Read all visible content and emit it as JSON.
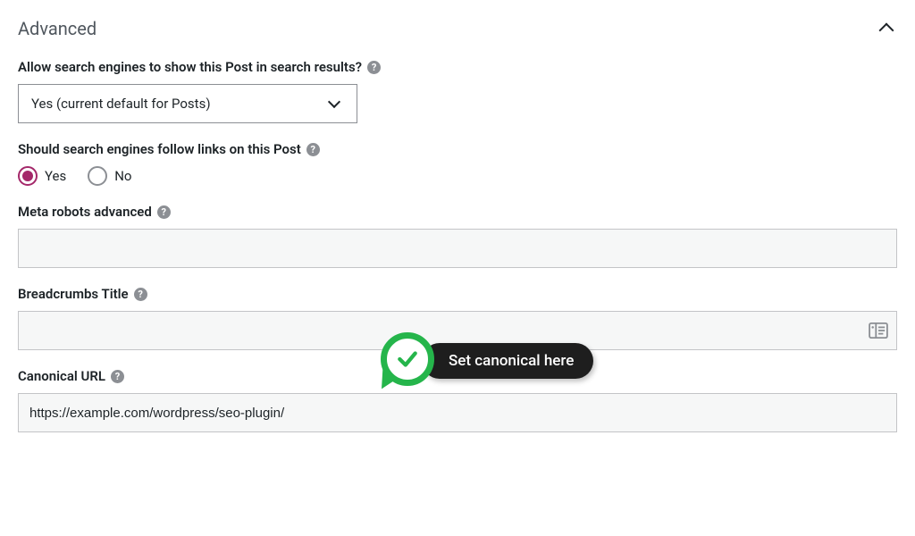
{
  "section": {
    "title": "Advanced"
  },
  "allow_index": {
    "label": "Allow search engines to show this Post in search results?",
    "selected": "Yes (current default for Posts)"
  },
  "follow_links": {
    "label": "Should search engines follow links on this Post",
    "options": {
      "yes": "Yes",
      "no": "No"
    },
    "selected": "yes"
  },
  "meta_robots": {
    "label": "Meta robots advanced",
    "value": ""
  },
  "breadcrumbs": {
    "label": "Breadcrumbs Title",
    "value": ""
  },
  "canonical": {
    "label": "Canonical URL",
    "value": "https://example.com/wordpress/seo-plugin/"
  },
  "callout": {
    "text": "Set canonical here"
  },
  "help_glyph": "?"
}
